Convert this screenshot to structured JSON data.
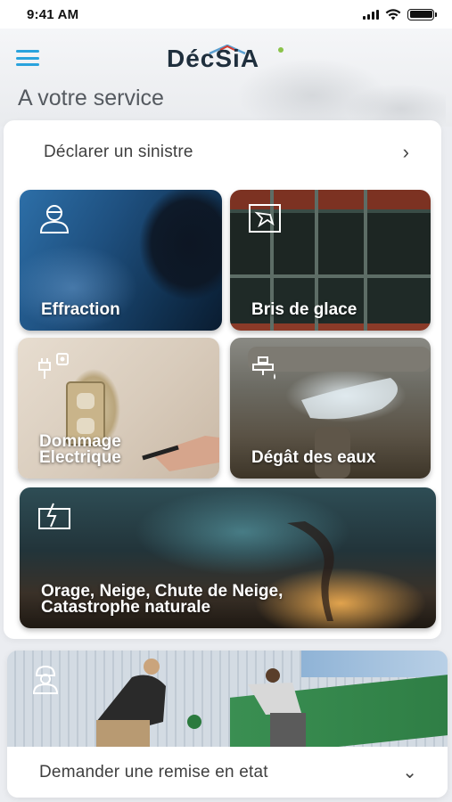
{
  "status_bar": {
    "time": "9:41 AM",
    "icons": [
      "signal-icon",
      "wifi-icon",
      "battery-icon"
    ]
  },
  "header": {
    "logo_text": "DécSiA",
    "title": "A votre service",
    "menu_icon": "hamburger-menu-icon"
  },
  "declare": {
    "label": "Déclarer un sinistre",
    "chevron": "›"
  },
  "tiles": [
    {
      "label": "Effraction",
      "icon": "worker-helmet-icon"
    },
    {
      "label": "Bris de glace",
      "icon": "broken-glass-icon"
    },
    {
      "label": "Dommage Electrique",
      "icon": "electric-plug-icon"
    },
    {
      "label": "Dégât des eaux",
      "icon": "water-pipe-icon"
    },
    {
      "label": "Orage, Neige, Chute de Neige, Catastrophe naturale",
      "icon": "storm-house-icon"
    }
  ],
  "remise": {
    "label": "Demander une remise en etat",
    "chevron": "⌄",
    "icon": "construction-worker-icon"
  },
  "colors": {
    "accent": "#2aa3dd",
    "logo_red": "#d83a2f",
    "background": "#ebedf1"
  }
}
